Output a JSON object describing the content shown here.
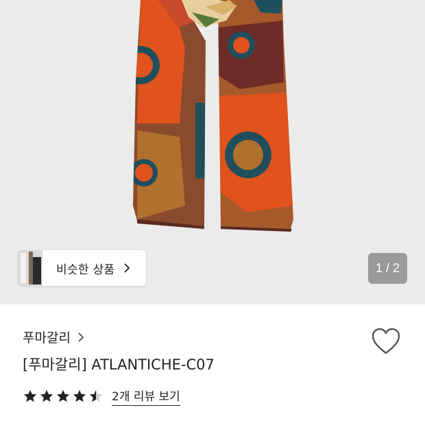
{
  "gallery": {
    "image_alt": "scarf",
    "similar_products_label": "비슷한 상품",
    "page_counter": "1 / 2",
    "background_color": "#ebebeb"
  },
  "product": {
    "brand": "푸마갈리",
    "title": "[푸마갈리] ATLANTICHE-C07",
    "rating": 4.5,
    "rating_max": 5,
    "review_link": "2개 리뷰 보기"
  },
  "icons": {
    "similar_chevron": "chevron-right-icon",
    "brand_chevron": "chevron-right-icon",
    "wishlist": "heart-outline-icon",
    "star": "star-icon"
  },
  "colors": {
    "text": "#222222",
    "counter_bg": "#9a9a9a",
    "scarf_orange": "#e0531e",
    "scarf_brown": "#8a4a2e",
    "scarf_teal": "#1f4f5c"
  }
}
